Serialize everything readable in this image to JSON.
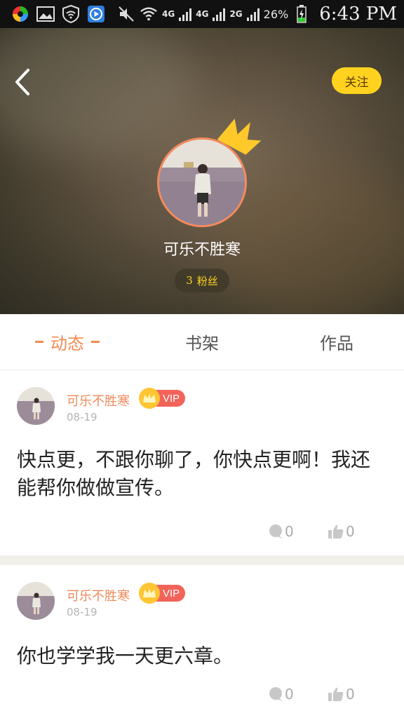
{
  "status_bar": {
    "net1": "4G",
    "net2": "4G",
    "net3": "2G",
    "battery": "26%",
    "time": "6:43 PM"
  },
  "profile": {
    "follow_label": "关注",
    "nickname": "可乐不胜寒",
    "fans_count": "3",
    "fans_label": "粉丝"
  },
  "tabs": [
    {
      "label": "动态",
      "active": true
    },
    {
      "label": "书架",
      "active": false
    },
    {
      "label": "作品",
      "active": false
    }
  ],
  "posts": [
    {
      "author": "可乐不胜寒",
      "badge": "VIP",
      "date": "08-19",
      "text": "快点更，不跟你聊了，你快点更啊！我还能帮你做做宣传。",
      "comments": "0",
      "likes": "0"
    },
    {
      "author": "可乐不胜寒",
      "badge": "VIP",
      "date": "08-19",
      "text": "你也学学我一天更六章。",
      "comments": "0",
      "likes": "0"
    }
  ],
  "colors": {
    "accent": "#f28a50",
    "follow_bg": "#ffd21f",
    "vip_red": "#f2635a"
  }
}
